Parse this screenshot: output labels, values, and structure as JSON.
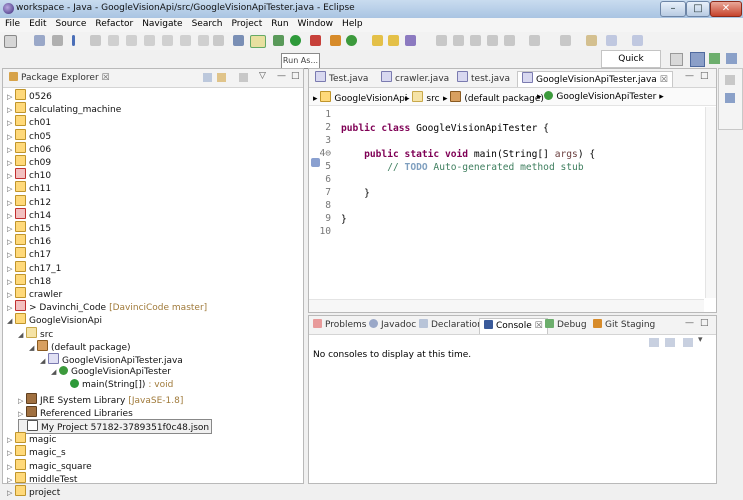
{
  "window": {
    "title": "workspace - Java - GoogleVisionApi/src/GoogleVisionApiTester.java - Eclipse"
  },
  "menu": [
    "File",
    "Edit",
    "Source",
    "Refactor",
    "Navigate",
    "Search",
    "Project",
    "Run",
    "Window",
    "Help"
  ],
  "toolbar": {
    "run_as_tooltip": "Run As...",
    "quick_access": "Quick Access"
  },
  "explorer": {
    "title": "Package Explorer",
    "items": [
      {
        "label": "0526",
        "kind": "proj",
        "indent": 0,
        "twisty": "▷"
      },
      {
        "label": "calculating_machine",
        "kind": "proj",
        "indent": 0,
        "twisty": "▷"
      },
      {
        "label": "ch01",
        "kind": "proj",
        "indent": 0,
        "twisty": "▷"
      },
      {
        "label": "ch05",
        "kind": "proj",
        "indent": 0,
        "twisty": "▷"
      },
      {
        "label": "ch06",
        "kind": "proj",
        "indent": 0,
        "twisty": "▷"
      },
      {
        "label": "ch09",
        "kind": "proj",
        "indent": 0,
        "twisty": "▷"
      },
      {
        "label": "ch10",
        "kind": "redp",
        "indent": 0,
        "twisty": "▷"
      },
      {
        "label": "ch11",
        "kind": "proj",
        "indent": 0,
        "twisty": "▷"
      },
      {
        "label": "ch12",
        "kind": "proj",
        "indent": 0,
        "twisty": "▷"
      },
      {
        "label": "ch14",
        "kind": "redp",
        "indent": 0,
        "twisty": "▷"
      },
      {
        "label": "ch15",
        "kind": "proj",
        "indent": 0,
        "twisty": "▷"
      },
      {
        "label": "ch16",
        "kind": "proj",
        "indent": 0,
        "twisty": "▷"
      },
      {
        "label": "ch17",
        "kind": "proj",
        "indent": 0,
        "twisty": "▷"
      },
      {
        "label": "ch17_1",
        "kind": "proj",
        "indent": 0,
        "twisty": "▷"
      },
      {
        "label": "ch18",
        "kind": "proj",
        "indent": 0,
        "twisty": "▷"
      },
      {
        "label": "crawler",
        "kind": "proj",
        "indent": 0,
        "twisty": "▷"
      },
      {
        "label": "> Davinchi_Code",
        "extra": "[DavinciCode master]",
        "kind": "redp",
        "indent": 0,
        "twisty": "▷"
      },
      {
        "label": "GoogleVisionApi",
        "kind": "proj",
        "indent": 0,
        "twisty": "◢"
      },
      {
        "label": "src",
        "kind": "folder",
        "indent": 1,
        "twisty": "◢"
      },
      {
        "label": "(default package)",
        "kind": "pkg",
        "indent": 2,
        "twisty": "◢"
      },
      {
        "label": "GoogleVisionApiTester.java",
        "kind": "java",
        "indent": 3,
        "twisty": "◢"
      },
      {
        "label": "GoogleVisionApiTester",
        "kind": "class",
        "indent": 4,
        "twisty": "◢"
      },
      {
        "label": "main(String[])",
        "extra": ": void",
        "kind": "method",
        "indent": 5,
        "twisty": ""
      },
      {
        "label": "JRE System Library",
        "extra": "[JavaSE-1.8]",
        "kind": "lib",
        "indent": 1,
        "twisty": "▷"
      },
      {
        "label": "Referenced Libraries",
        "kind": "lib",
        "indent": 1,
        "twisty": "▷"
      },
      {
        "label": "My Project 57182-3789351f0c48.json",
        "kind": "file",
        "indent": 1,
        "twisty": "",
        "selected": true
      },
      {
        "label": "magic",
        "kind": "proj",
        "indent": 0,
        "twisty": "▷"
      },
      {
        "label": "magic_s",
        "kind": "proj",
        "indent": 0,
        "twisty": "▷"
      },
      {
        "label": "magic_square",
        "kind": "proj",
        "indent": 0,
        "twisty": "▷"
      },
      {
        "label": "middleTest",
        "kind": "proj",
        "indent": 0,
        "twisty": "▷"
      },
      {
        "label": "project",
        "kind": "proj",
        "indent": 0,
        "twisty": "▷"
      }
    ]
  },
  "editor": {
    "tabs": [
      "Test.java",
      "crawler.java",
      "test.java",
      "GoogleVisionApiTester.java"
    ],
    "breadcrumb": [
      "GoogleVisionApi",
      "src",
      "(default package)",
      "GoogleVisionApiTester"
    ],
    "lines": [
      {
        "n": "1",
        "segs": []
      },
      {
        "n": "2",
        "segs": [
          {
            "t": "public class ",
            "c": "kw"
          },
          {
            "t": "GoogleVisionApiTester {",
            "c": ""
          }
        ]
      },
      {
        "n": "3",
        "segs": []
      },
      {
        "n": "4⊖",
        "segs": [
          {
            "t": "    ",
            "c": ""
          },
          {
            "t": "public static void ",
            "c": "kw"
          },
          {
            "t": "main(String[] ",
            "c": ""
          },
          {
            "t": "args",
            "c": "arg"
          },
          {
            "t": ") {",
            "c": ""
          }
        ]
      },
      {
        "n": "5",
        "segs": [
          {
            "t": "        ",
            "c": ""
          },
          {
            "t": "// ",
            "c": "cm"
          },
          {
            "t": "TODO",
            "c": "todo"
          },
          {
            "t": " Auto-generated method stub",
            "c": "cm"
          }
        ]
      },
      {
        "n": "6",
        "segs": []
      },
      {
        "n": "7",
        "segs": [
          {
            "t": "    }",
            "c": ""
          }
        ]
      },
      {
        "n": "8",
        "segs": []
      },
      {
        "n": "9",
        "segs": [
          {
            "t": "}",
            "c": ""
          }
        ]
      },
      {
        "n": "10",
        "segs": []
      }
    ]
  },
  "console": {
    "tabs": [
      "Problems",
      "Javadoc",
      "Declaration",
      "Console",
      "Debug",
      "Git Staging"
    ],
    "message": "No consoles to display at this time."
  }
}
